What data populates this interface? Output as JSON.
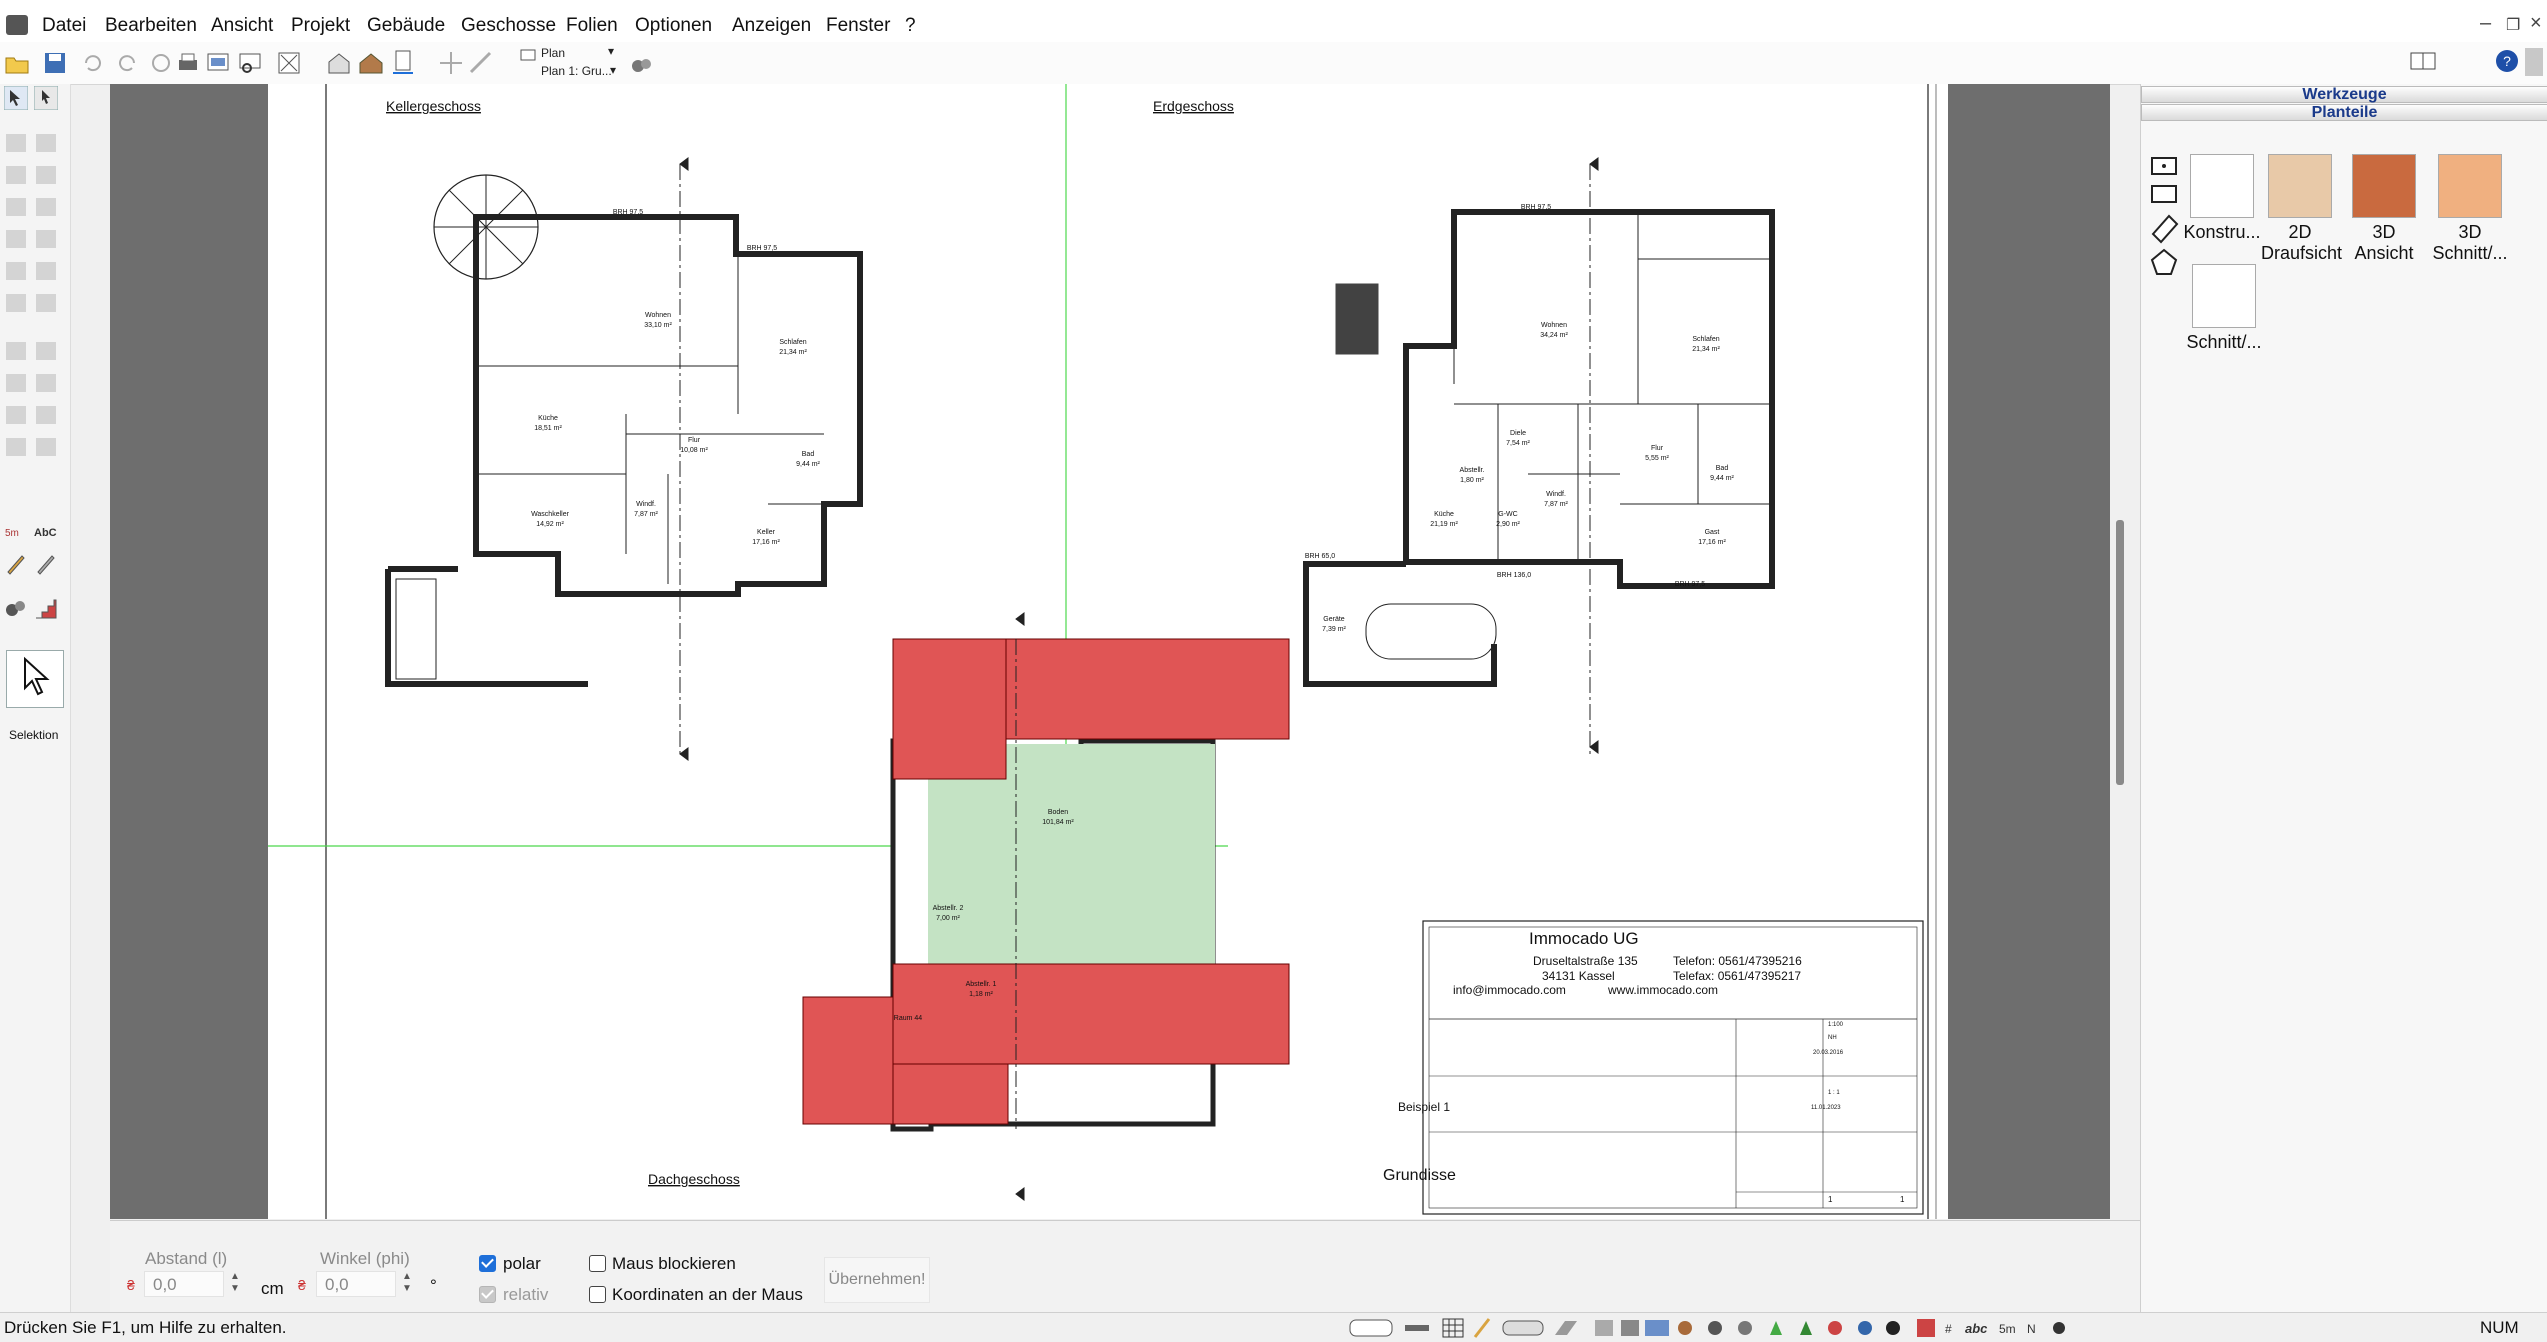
{
  "menu": {
    "items": [
      "Datei",
      "Bearbeiten",
      "Ansicht",
      "Projekt",
      "Gebäude",
      "Geschosse",
      "Folien",
      "Optionen",
      "Anzeigen",
      "Fenster",
      "?"
    ]
  },
  "toolbar": {
    "combo_plan": "Plan",
    "combo_plan_page": "Plan 1: Gru..."
  },
  "left_tools": {
    "selection_label": "Selektion"
  },
  "plan": {
    "kellergeschoss_title": "Kellergeschoss",
    "erdgeschoss_title": "Erdgeschoss",
    "dachgeschoss_title": "Dachgeschoss",
    "kg_rooms": [
      {
        "name": "Wohnen",
        "area": "33,10 m²"
      },
      {
        "name": "Schlafen",
        "area": "21,34 m²"
      },
      {
        "name": "Küche",
        "area": "18,51 m²"
      },
      {
        "name": "Flur",
        "area": "10,08 m²"
      },
      {
        "name": "Bad",
        "area": "9,44 m²"
      },
      {
        "name": "Waschkeller",
        "area": "14,92 m²"
      },
      {
        "name": "Windf.",
        "area": "7,87 m²"
      },
      {
        "name": "Keller",
        "area": "17,16 m²"
      }
    ],
    "eg_rooms": [
      {
        "name": "Wohnen",
        "area": "34,24 m²"
      },
      {
        "name": "Schlafen",
        "area": "21,34 m²"
      },
      {
        "name": "Diele",
        "area": "7,54 m²"
      },
      {
        "name": "Flur",
        "area": "5,55 m²"
      },
      {
        "name": "Bad",
        "area": "9,44 m²"
      },
      {
        "name": "Abstellr.",
        "area": "1,80 m²"
      },
      {
        "name": "Küche",
        "area": "21,19 m²"
      },
      {
        "name": "G-WC",
        "area": "2,90 m²"
      },
      {
        "name": "Windf.",
        "area": "7,87 m²"
      },
      {
        "name": "Gast",
        "area": "17,16 m²"
      },
      {
        "name": "Geräte",
        "area": "7,39 m²"
      }
    ],
    "dg_rooms": [
      {
        "name": "Boden",
        "area": "101,84 m²"
      },
      {
        "name": "Abstellr. 2",
        "area": "7,00 m²"
      },
      {
        "name": "Abstellr. 1",
        "area": "1,18 m²"
      },
      {
        "name": "Raum 44",
        "area": ""
      }
    ],
    "brh_labels": [
      "BRH 97,5",
      "BRH 97,5",
      "BRH 97,5",
      "BRH 97,5",
      "BRH 136,0",
      "BRH 65,0"
    ],
    "titleblock": {
      "company": "Immocado UG",
      "street": "Druseltalstraße 135",
      "city": "34131 Kassel",
      "phone": "Telefon: 0561/47395216",
      "fax": "Telefax: 0561/47395217",
      "email": "info@immocado.com",
      "web": "www.immocado.com",
      "project": "Beispiel 1",
      "plan_name": "Grundisse",
      "scale": "1:100",
      "date1": "20.03.2016",
      "sheet": "1 : 1",
      "date2": "11.01.2023",
      "plan_nr": "1",
      "index": "1",
      "drawn": "NH"
    }
  },
  "bottom": {
    "distance_label": "Abstand (l)",
    "distance_value": "0,0",
    "distance_unit": "cm",
    "angle_label": "Winkel (phi)",
    "angle_value": "0,0",
    "angle_unit": "°",
    "polar_label": "polar",
    "relativ_label": "relativ",
    "maus_blockieren_label": "Maus blockieren",
    "koordinaten_label": "Koordinaten an der Maus",
    "apply_label": "Übernehmen!"
  },
  "right_panel": {
    "werkzeuge_header": "Werkzeuge",
    "planteile_header": "Planteile",
    "planteile": [
      {
        "line1": "Konstru...",
        "line2": ""
      },
      {
        "line1": "2D",
        "line2": "Draufsicht"
      },
      {
        "line1": "3D",
        "line2": "Ansicht"
      },
      {
        "line1": "3D",
        "line2": "Schnitt/..."
      },
      {
        "line1": "Schnitt/...",
        "line2": ""
      }
    ]
  },
  "status": {
    "help_text": "Drücken Sie F1, um Hilfe zu erhalten.",
    "num": "NUM"
  },
  "colors": {
    "roof_red": "#e05555",
    "floor_green": "#c4e3c4",
    "guide_green": "#4cd84c",
    "accent_blue": "#1e6fd9"
  }
}
